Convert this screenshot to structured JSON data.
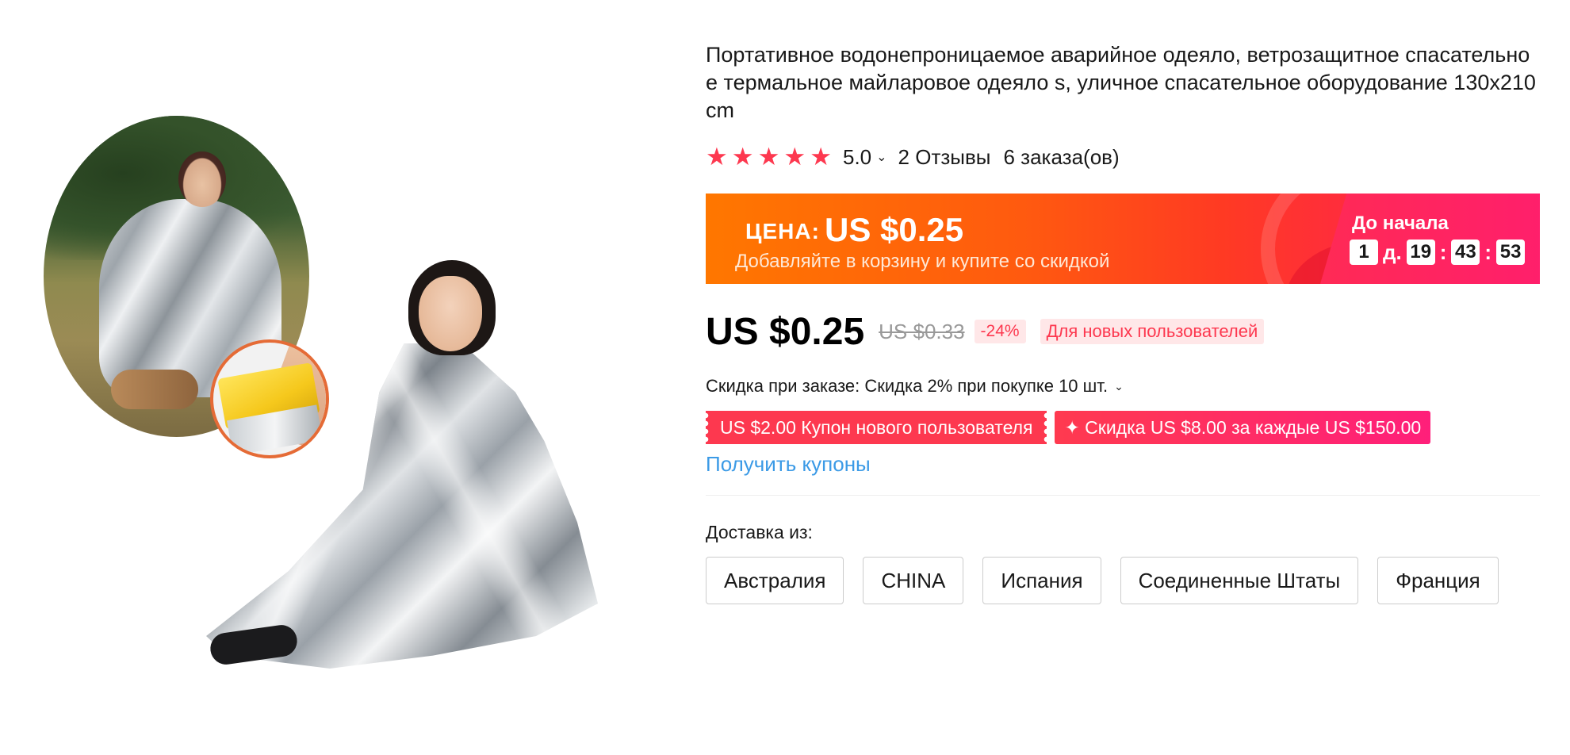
{
  "product": {
    "title": "Портативное водонепроницаемое аварийное одеяло, ветрозащитное спасательное термальное майларовое одеяло s, уличное спасательное оборудование 130x210cm",
    "image_alt": "Spasatelnoe odeyalo"
  },
  "rating": {
    "stars": 5,
    "value": "5.0",
    "reviews": "2 Отзывы",
    "orders": "6 заказа(ов)"
  },
  "promo": {
    "price_label": "ЦЕНА:",
    "price": "US $0.25",
    "subtitle": "Добавляйте в корзину и купите со скидкой",
    "countdown_title": "До начала",
    "countdown": {
      "days": "1",
      "days_unit": "д.",
      "hours": "19",
      "minutes": "43",
      "seconds": "53"
    }
  },
  "pricing": {
    "current": "US $0.25",
    "original": "US $0.33",
    "discount": "-24%",
    "new_user_badge": "Для новых пользователей"
  },
  "bulk": {
    "text": "Скидка при заказе: Скидка 2% при покупке 10 шт."
  },
  "coupons": {
    "new_user": "US $2.00 Купон нового пользователя",
    "store": "✦ Скидка US $8.00 за каждые US $150.00",
    "get_link": "Получить купоны"
  },
  "shipping": {
    "label": "Доставка из:",
    "options": [
      "Австралия",
      "CHINA",
      "Испания",
      "Соединенные Штаты",
      "Франция"
    ]
  },
  "colors": {
    "accent_red": "#fd384f",
    "promo_orange": "#ff7700",
    "promo_pink": "#ff1f6b",
    "link_blue": "#3b9ae6"
  }
}
